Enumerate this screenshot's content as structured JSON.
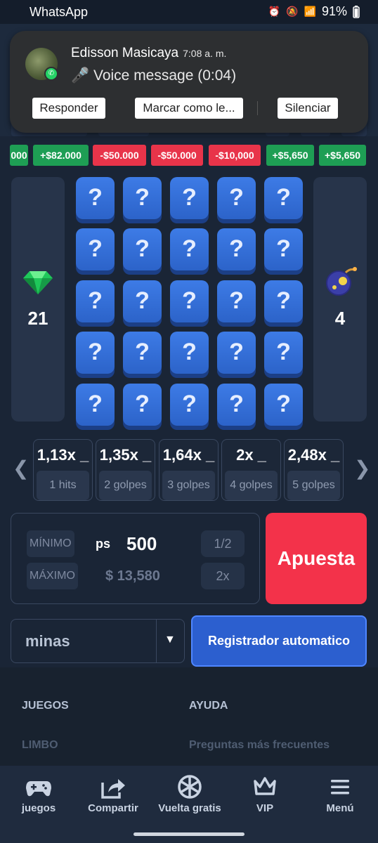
{
  "status_bar": {
    "app": "WhatsApp",
    "battery": "91%"
  },
  "notification": {
    "sender": "Edisson Masicaya",
    "time": "7:08 a. m.",
    "message": "🎤 Voice message (0:04)",
    "actions": [
      "Responder",
      "Marcar como le...",
      "Silenciar"
    ]
  },
  "history": [
    "000",
    "+$82.000",
    "-$50.000",
    "-$50.000",
    "-$10,000",
    "+$5,650",
    "+$5,650"
  ],
  "history_types": [
    "win",
    "win",
    "loss",
    "loss",
    "loss",
    "win",
    "win"
  ],
  "game": {
    "gems": "21",
    "mines": "4",
    "tile_symbol": "?",
    "rows": 5,
    "cols": 5
  },
  "multipliers": [
    {
      "value": "1,13x _",
      "hits": "1 hits"
    },
    {
      "value": "1,35x _",
      "hits": "2 golpes"
    },
    {
      "value": "1,64x _",
      "hits": "3 golpes"
    },
    {
      "value": "2x _",
      "hits": "4 golpes"
    },
    {
      "value": "2,48x _",
      "hits": "5 golpes"
    }
  ],
  "bet": {
    "min_label": "MÍNIMO",
    "max_label": "MÁXIMO",
    "currency": "ps",
    "amount": "500",
    "max_amount": "$ 13,580",
    "half": "1/2",
    "double": "2x",
    "bet_button": "Apuesta"
  },
  "game_select": {
    "value": "minas"
  },
  "auto_button": "Registrador automatico",
  "footer": {
    "col1_title": "JUEGOS",
    "col1_link": "LIMBO",
    "col2_title": "AYUDA",
    "col2_link": "Preguntas más frecuentes"
  },
  "bottom_nav": [
    "juegos",
    "Compartir",
    "Vuelta gratis",
    "VIP",
    "Menú"
  ]
}
